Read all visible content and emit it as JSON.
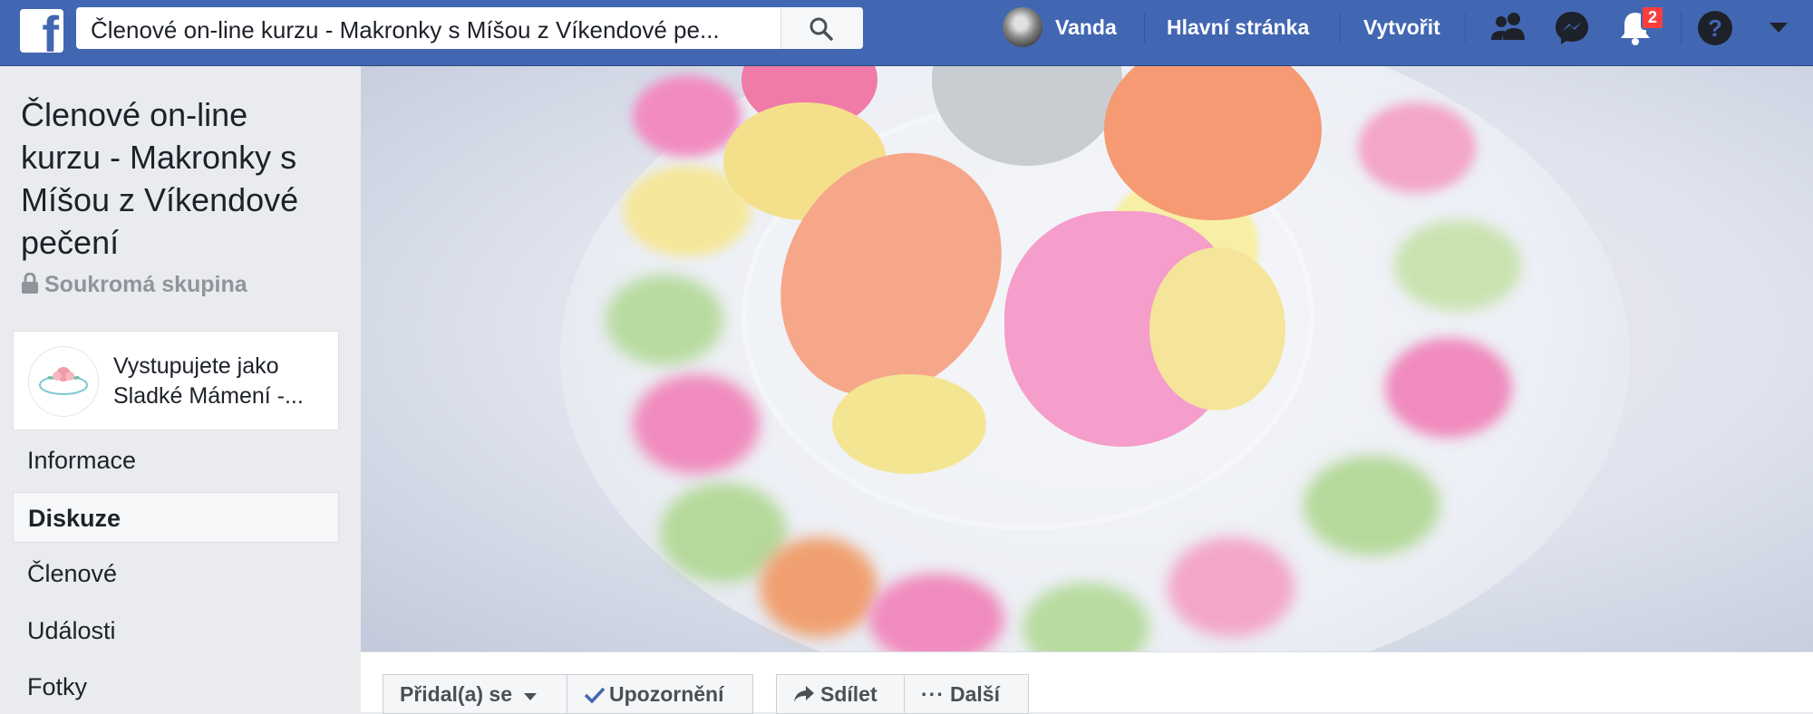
{
  "topbar": {
    "search_value": "Členové on-line kurzu - Makronky s Míšou z Víkendové pe...",
    "user_name": "Vanda",
    "home_label": "Hlavní stránka",
    "create_label": "Vytvořit",
    "notification_count": "2",
    "icons": [
      "facebook-logo",
      "search-icon",
      "friends-icon",
      "messenger-icon",
      "bell-icon",
      "help-icon",
      "chevron-down-icon"
    ]
  },
  "sidebar": {
    "group_title": "Členové on-line kurzu - Makronky s Míšou z Víkendové pečení",
    "privacy": "Soukromá skupina",
    "acting_as": "Vystupujete jako Sladké Mámení -...",
    "menu": [
      "Informace",
      "Diskuze",
      "Členové",
      "Události",
      "Fotky"
    ],
    "active_item": "Diskuze"
  },
  "actions": {
    "joined_label": "Přidal(a) se",
    "notifications_label": "Upozornění",
    "share_label": "Sdílet",
    "more_label": "Další"
  },
  "colors": {
    "brand": "#4267b2",
    "badge": "#fa3e3e",
    "background": "#e9ebee"
  }
}
